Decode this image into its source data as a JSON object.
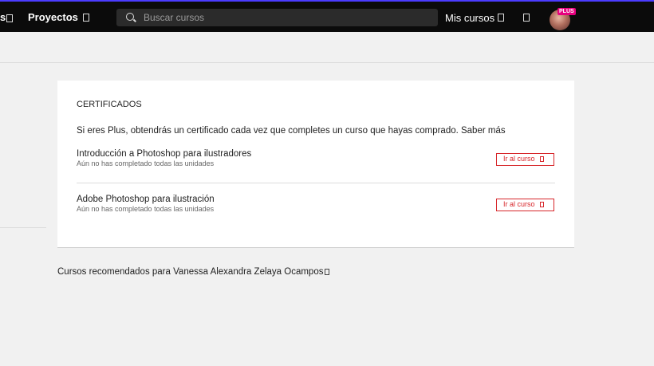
{
  "topbar": {
    "nav_cut_text": "s",
    "projects_label": "Proyectos",
    "search_placeholder": "Buscar cursos",
    "my_courses_label": "Mis cursos",
    "plus_badge": "PLUS"
  },
  "certificates": {
    "title": "CERTIFICADOS",
    "intro": "Si eres Plus, obtendrás un certificado cada vez que completes un curso que hayas comprado. Saber más",
    "courses": [
      {
        "name": "Introducción a Photoshop para ilustradores",
        "status": "Aún no has completado todas las unidades",
        "button": "Ir al curso"
      },
      {
        "name": "Adobe Photoshop para ilustración",
        "status": "Aún no has completado todas las unidades",
        "button": "Ir al curso"
      }
    ]
  },
  "recommended": {
    "label": "Cursos recomendados para Vanessa Alexandra Zelaya Ocampos"
  },
  "colors": {
    "accent": "#d7262a",
    "topbar": "#0b0b0b",
    "plus_badge": "#e6007e",
    "top_border": "#4b3cff"
  }
}
